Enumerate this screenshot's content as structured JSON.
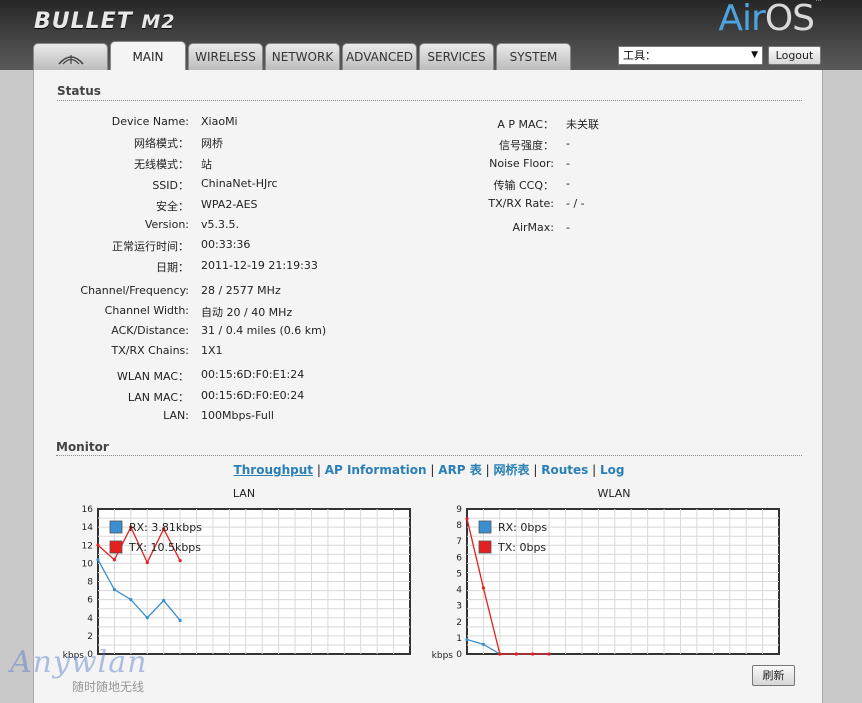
{
  "header": {
    "brand": "BULLET",
    "model": "M2",
    "airos_prefix": "Air",
    "airos_suffix": "OS",
    "tm": "™"
  },
  "tabs": [
    {
      "label": "",
      "icon": "ubiquiti-logo-icon"
    },
    {
      "label": "MAIN"
    },
    {
      "label": "WIRELESS"
    },
    {
      "label": "NETWORK"
    },
    {
      "label": "ADVANCED"
    },
    {
      "label": "SERVICES"
    },
    {
      "label": "SYSTEM"
    }
  ],
  "active_tab": "MAIN",
  "tools": {
    "selected": "工具：",
    "icon": "chevron-down-icon"
  },
  "logout_label": "Logout",
  "status": {
    "title": "Status",
    "left": [
      {
        "label": "Device Name:",
        "value": "XiaoMi"
      },
      {
        "label": "网络模式：",
        "value": "网桥"
      },
      {
        "label": "无线模式：",
        "value": "站"
      },
      {
        "label": "SSID：",
        "value": "ChinaNet-HJrc"
      },
      {
        "label": "安全：",
        "value": "WPA2-AES"
      },
      {
        "label": "Version:",
        "value": "v5.3.5."
      },
      {
        "label": "正常运行时间：",
        "value": "00:33:36"
      },
      {
        "label": "日期：",
        "value": "2011-12-19 21:19:33"
      },
      {
        "label": "Channel/Frequency:",
        "value": "28 / 2577 MHz"
      },
      {
        "label": "Channel Width:",
        "value": "自动 20 / 40 MHz"
      },
      {
        "label": "ACK/Distance:",
        "value": "31 / 0.4 miles (0.6 km)"
      },
      {
        "label": "TX/RX Chains:",
        "value": "1X1"
      },
      {
        "label": "WLAN MAC：",
        "value": "00:15:6D:F0:E1:24"
      },
      {
        "label": "LAN MAC：",
        "value": "00:15:6D:F0:E0:24"
      },
      {
        "label": "LAN:",
        "value": "100Mbps-Full"
      }
    ],
    "right": [
      {
        "label": "A P MAC：",
        "value": "未关联"
      },
      {
        "label": "信号强度：",
        "value": "-"
      },
      {
        "label": "Noise Floor:",
        "value": "-"
      },
      {
        "label": "传输 CCQ：",
        "value": "-"
      },
      {
        "label": "TX/RX Rate:",
        "value": "- / -"
      },
      {
        "label": "AirMax:",
        "value": "-"
      }
    ]
  },
  "monitor": {
    "title": "Monitor",
    "links": [
      {
        "label": "Throughput",
        "active": true
      },
      {
        "label": "AP Information",
        "active": false
      },
      {
        "label": "ARP 表",
        "active": false
      },
      {
        "label": "网桥表",
        "active": false
      },
      {
        "label": "Routes",
        "active": false
      },
      {
        "label": "Log",
        "active": false
      }
    ],
    "separator": "|"
  },
  "refresh_label": "刷新",
  "watermark": {
    "main": "Anywlan",
    "sub": "随时随地无线"
  },
  "chart_data": [
    {
      "type": "line",
      "title": "LAN",
      "ylabel": "kbps",
      "ylim": [
        0,
        16
      ],
      "yticks": [
        0,
        2,
        4,
        6,
        8,
        10,
        12,
        14,
        16
      ],
      "x": [
        0,
        1,
        2,
        3,
        4,
        5
      ],
      "xlim": [
        0,
        19
      ],
      "grid": true,
      "legend": "top-left",
      "series": [
        {
          "name": "RX: 3.81kbps",
          "color": "#3a8fd0",
          "values": [
            10.4,
            7.1,
            6.0,
            4.0,
            5.9,
            3.7
          ]
        },
        {
          "name": "TX: 10.5kbps",
          "color": "#e52020",
          "values": [
            12.0,
            10.4,
            14.0,
            10.1,
            13.8,
            10.3
          ]
        }
      ]
    },
    {
      "type": "line",
      "title": "WLAN",
      "ylabel": "kbps",
      "ylim": [
        0,
        9
      ],
      "yticks": [
        0,
        1,
        2,
        3,
        4,
        5,
        6,
        7,
        8,
        9
      ],
      "x": [
        0,
        1,
        2,
        3,
        4,
        5
      ],
      "xlim": [
        0,
        19
      ],
      "grid": true,
      "legend": "top-left",
      "series": [
        {
          "name": "RX: 0bps",
          "color": "#3a8fd0",
          "values": [
            0.9,
            0.6,
            0,
            0,
            0,
            0
          ]
        },
        {
          "name": "TX: 0bps",
          "color": "#e52020",
          "values": [
            8.4,
            4.1,
            0,
            0,
            0,
            0
          ]
        }
      ]
    }
  ]
}
